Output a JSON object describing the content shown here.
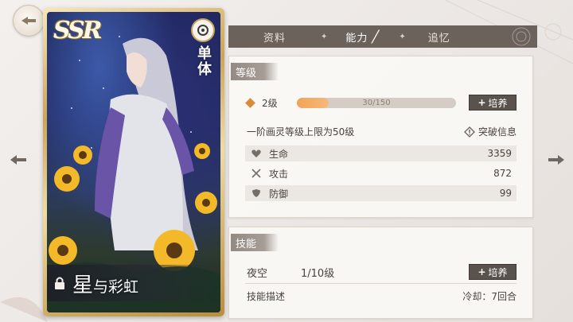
{
  "card": {
    "rarity": "SSR",
    "target_type": "单体",
    "name_part1": "星",
    "name_part2": "与彩虹"
  },
  "tabs": [
    {
      "label": "资料",
      "active": false
    },
    {
      "label": "能力",
      "active": true
    },
    {
      "label": "追忆",
      "active": false
    }
  ],
  "level_panel": {
    "header": "等级",
    "level_label": "2级",
    "exp_text": "30/150",
    "exp_progress": 0.2,
    "train_button": "培养",
    "cap_text": "一阶画灵等级上限为50级",
    "breakthrough_label": "突破信息",
    "stats": [
      {
        "icon": "heart-icon",
        "label": "生命",
        "value": "3359"
      },
      {
        "icon": "swords-icon",
        "label": "攻击",
        "value": "872"
      },
      {
        "icon": "shield-icon",
        "label": "防御",
        "value": "99"
      }
    ]
  },
  "skill_panel": {
    "header": "技能",
    "skill_name": "夜空",
    "skill_level": "1/10级",
    "train_button": "培养",
    "desc_label": "技能描述",
    "cooldown": "冷却：7回合"
  },
  "colors": {
    "accent_orange": "#f2a458",
    "dark_button": "#5a524d",
    "tab_bar": "#6b625c"
  }
}
